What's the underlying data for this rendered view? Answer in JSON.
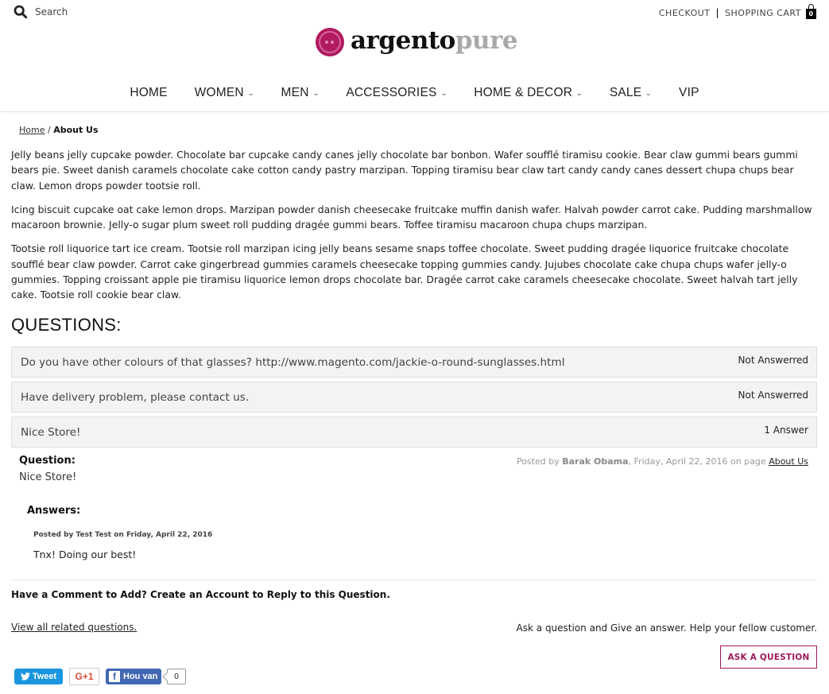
{
  "header": {
    "search_label": "Search",
    "checkout_label": "CHECKOUT",
    "separator": "|",
    "cart_label": "SHOPPING CART",
    "cart_count": "0",
    "logo": {
      "part1": "argento",
      "part2": "pure",
      "brand_color": "#b01a5f"
    }
  },
  "nav": {
    "items": [
      {
        "label": "HOME",
        "has_dropdown": false
      },
      {
        "label": "WOMEN",
        "has_dropdown": true
      },
      {
        "label": "MEN",
        "has_dropdown": true
      },
      {
        "label": "ACCESSORIES",
        "has_dropdown": true
      },
      {
        "label": "HOME & DECOR",
        "has_dropdown": true
      },
      {
        "label": "SALE",
        "has_dropdown": true
      },
      {
        "label": "VIP",
        "has_dropdown": false
      }
    ],
    "chevron": "⌄"
  },
  "breadcrumb": {
    "home": "Home",
    "separator": " / ",
    "current": "About Us"
  },
  "content": {
    "paragraphs": [
      "Jelly beans jelly cupcake powder. Chocolate bar cupcake candy canes jelly chocolate bar bonbon. Wafer soufflé tiramisu cookie. Bear claw gummi bears gummi bears pie. Sweet danish caramels chocolate cake cotton candy pastry marzipan. Topping tiramisu bear claw tart candy candy canes dessert chupa chups bear claw. Lemon drops powder tootsie roll.",
      "Icing biscuit cupcake oat cake lemon drops. Marzipan powder danish cheesecake fruitcake muffin danish wafer. Halvah powder carrot cake. Pudding marshmallow macaroon brownie. Jelly-o sugar plum sweet roll pudding dragée gummi bears. Toffee tiramisu macaroon chupa chups marzipan.",
      "Tootsie roll liquorice tart ice cream. Tootsie roll marzipan icing jelly beans sesame snaps toffee chocolate. Sweet pudding dragée liquorice fruitcake chocolate soufflé bear claw powder. Carrot cake gingerbread gummies caramels cheesecake topping gummies candy. Jujubes chocolate cake chupa chups wafer jelly-o gummies. Topping croissant apple pie tiramisu liquorice lemon drops chocolate bar. Dragée carrot cake caramels cheesecake chocolate. Sweet halvah tart jelly cake. Tootsie roll cookie bear claw."
    ]
  },
  "questions": {
    "title": "QUESTIONS:",
    "items": [
      {
        "text": "Do you have other colours of that glasses? http://www.magento.com/jackie-o-round-sunglasses.html",
        "status": "Not Answerred"
      },
      {
        "text": "Have delivery problem, please contact us.",
        "status": "Not Answerred"
      },
      {
        "text": "Nice Store!",
        "status": "1 Answer"
      }
    ]
  },
  "question_detail": {
    "label": "Question:",
    "text": "Nice Store!",
    "posted_by_prefix": "Posted by ",
    "author": "Barak Obama",
    "date_part": ", Friday, April 22, 2016 on page ",
    "page_link": "About Us",
    "answers_label": "Answers:",
    "answers": [
      {
        "meta": "Posted by Test Test on Friday, April 22, 2016",
        "text": "Tnx! Doing our best!"
      }
    ]
  },
  "footer": {
    "comment_prompt": "Have a Comment to Add? Create an Account to Reply to this Question.",
    "view_all_link": "View all related questions.",
    "ask_text": "Ask a question and Give an answer. Help your fellow customer.",
    "ask_button": "ASK A QUESTION",
    "accent_color": "#9e1b5b"
  },
  "social": {
    "tweet_label": "Tweet",
    "gplus_label": "G+1",
    "fb_label": "Hou van",
    "fb_count": "0",
    "colors": {
      "twitter": "#1b95e0",
      "google": "#dd4b39",
      "facebook": "#4267b2"
    }
  }
}
